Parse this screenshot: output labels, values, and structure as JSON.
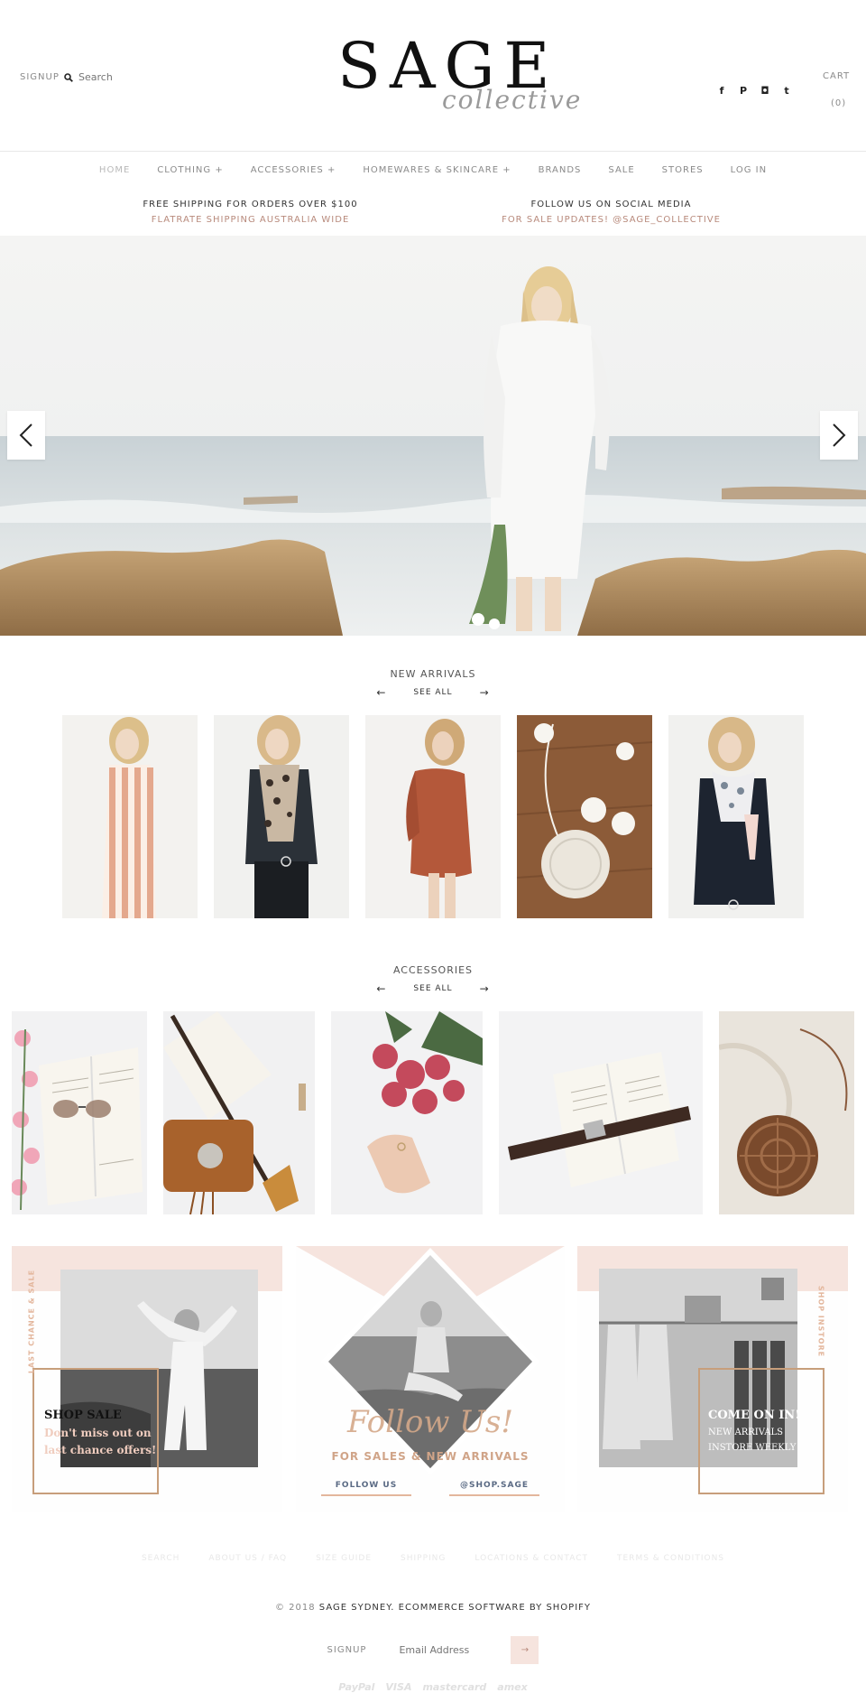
{
  "header": {
    "signup": "SIGNUP",
    "search_placeholder": "Search",
    "logo_main": "SAGE",
    "logo_sub": "collective",
    "cart_label": "CART",
    "cart_count": "(0)",
    "social_icons": [
      "facebook-icon",
      "pinterest-icon",
      "instagram-icon",
      "tumblr-icon"
    ],
    "social_glyphs": [
      "f",
      "P",
      "◘",
      "t"
    ]
  },
  "nav": {
    "items": [
      {
        "label": "HOME"
      },
      {
        "label": "CLOTHING +"
      },
      {
        "label": "ACCESSORIES +"
      },
      {
        "label": "HOMEWARES & SKINCARE +"
      },
      {
        "label": "BRANDS"
      },
      {
        "label": "SALE"
      },
      {
        "label": "STORES"
      },
      {
        "label": "LOG IN"
      }
    ]
  },
  "info": {
    "left_line1": "FREE SHIPPING FOR ORDERS OVER $100",
    "left_line2": "FLATRATE SHIPPING AUSTRALIA WIDE",
    "right_line1": "FOLLOW US ON SOCIAL MEDIA",
    "right_line2": "FOR SALE UPDATES! @SAGE_COLLECTIVE"
  },
  "new_arrivals": {
    "title": "NEW ARRIVALS",
    "see_all": "SEE ALL",
    "prev": "←",
    "next": "→"
  },
  "accessories": {
    "title": "ACCESSORIES",
    "see_all": "SEE ALL",
    "prev": "←",
    "next": "→"
  },
  "promos": {
    "left": {
      "vertical": "LAST CHANCE & SALE",
      "title": "SHOP SALE",
      "line1": "Don't miss out on",
      "line2": "last chance offers!"
    },
    "center": {
      "script": "Follow Us!",
      "subtitle": "FOR SALES & NEW ARRIVALS",
      "btn_left": "FOLLOW US",
      "btn_right": "@SHOP.SAGE"
    },
    "right": {
      "vertical": "SHOP INSTORE",
      "title": "COME ON IN!",
      "line1": "NEW ARRIVALS",
      "line2": "INSTORE WEEKLY"
    }
  },
  "footer": {
    "links": [
      "SEARCH",
      "ABOUT US / FAQ",
      "SIZE GUIDE",
      "SHIPPING",
      "LOCATIONS & CONTACT",
      "TERMS & CONDITIONS"
    ],
    "copyright_prefix": "© 2018",
    "copyright_main": "SAGE SYDNEY. ECOMMERCE SOFTWARE BY SHOPIFY",
    "signup_label": "SIGNUP",
    "email_placeholder": "Email Address",
    "submit": "→",
    "payments": [
      "PayPal",
      "VISA",
      "mastercard",
      "amex"
    ]
  },
  "colors": {
    "accent": "#b88a7c",
    "blush": "#f6e4de"
  }
}
